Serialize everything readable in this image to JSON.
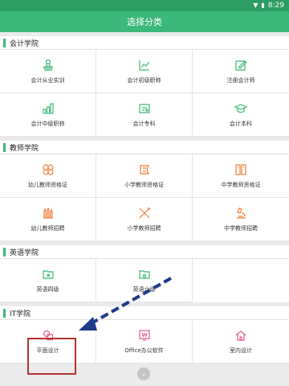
{
  "status": {
    "time": "8:29",
    "wifi_icon": "wifi-icon",
    "battery_icon": "battery-icon"
  },
  "appbar": {
    "title": "选择分类"
  },
  "sections": [
    {
      "title": "会计学院",
      "items": [
        {
          "label": "会计从业实训",
          "icon": "stamp-icon",
          "color": "#3cb878"
        },
        {
          "label": "会计初级职称",
          "icon": "trend-chart-icon",
          "color": "#3cb878"
        },
        {
          "label": "注册会计师",
          "icon": "edit-doc-icon",
          "color": "#3cb878"
        },
        {
          "label": "会计中级职称",
          "icon": "bar-chart-icon",
          "color": "#3cb878"
        },
        {
          "label": "会计专科",
          "icon": "certificate-icon",
          "color": "#3cb878"
        },
        {
          "label": "会计本科",
          "icon": "graduation-cap-icon",
          "color": "#3cb878"
        }
      ]
    },
    {
      "title": "教师学院",
      "items": [
        {
          "label": "幼儿教师资格证",
          "icon": "blocks-icon",
          "color": "#f07d3a"
        },
        {
          "label": "小学教师资格证",
          "icon": "badge-icon",
          "color": "#f07d3a"
        },
        {
          "label": "中学教师资格证",
          "icon": "open-book-icon",
          "color": "#f07d3a"
        },
        {
          "label": "幼儿教师招聘",
          "icon": "crayons-icon",
          "color": "#f07d3a"
        },
        {
          "label": "小学教师招聘",
          "icon": "pencil-ruler-icon",
          "color": "#f07d3a"
        },
        {
          "label": "中学教师招聘",
          "icon": "microscope-icon",
          "color": "#f07d3a"
        }
      ]
    },
    {
      "title": "英语学院",
      "items": [
        {
          "label": "英语四级",
          "icon": "folder-4-icon",
          "color": "#3cb878"
        },
        {
          "label": "英语六级",
          "icon": "folder-6-icon",
          "color": "#3cb878"
        }
      ]
    },
    {
      "title": "IT学院",
      "items": [
        {
          "label": "平面设计",
          "icon": "design-shapes-icon",
          "color": "#e2588f"
        },
        {
          "label": "Office办公软件",
          "icon": "word-doc-icon",
          "color": "#e2588f"
        },
        {
          "label": "室内设计",
          "icon": "house-icon",
          "color": "#e2588f"
        }
      ]
    }
  ],
  "overlay": {
    "scroll_icon": "chevron-down-icon"
  }
}
